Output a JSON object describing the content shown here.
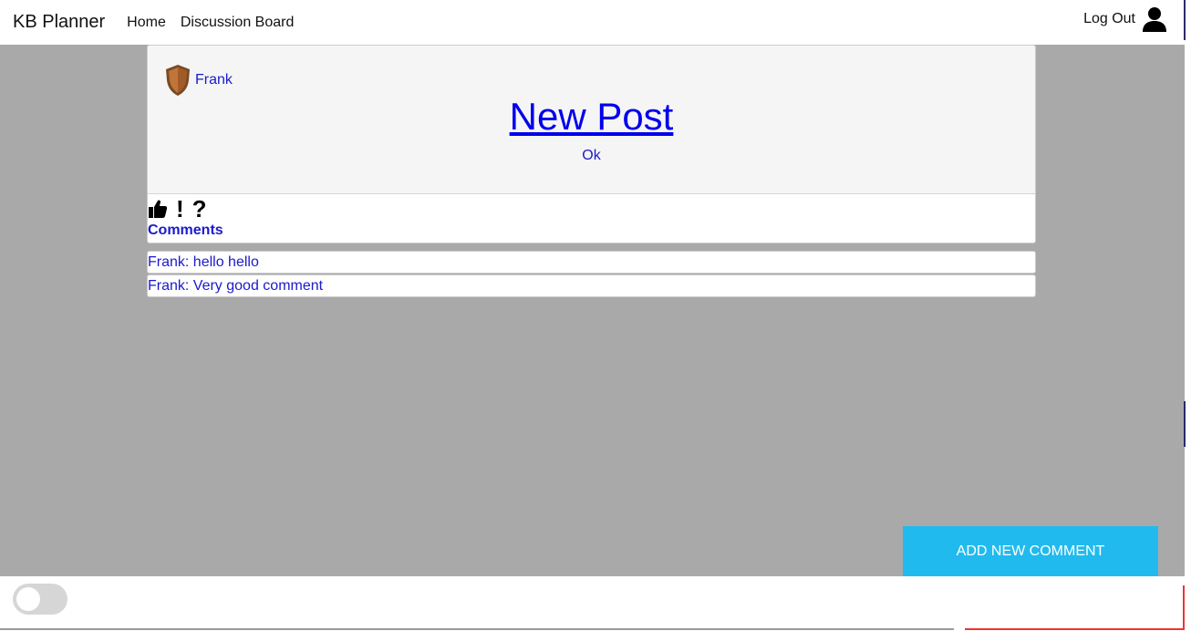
{
  "nav": {
    "brand": "KB Planner",
    "links": [
      "Home",
      "Discussion Board"
    ],
    "logout": "Log Out"
  },
  "post": {
    "author": "Frank",
    "title": "New Post",
    "body": "Ok",
    "reactions": [
      "thumbs-up",
      "!",
      "?"
    ],
    "comments_label": "Comments"
  },
  "comments": [
    {
      "text": "Frank: hello hello"
    },
    {
      "text": "Frank: Very good comment"
    }
  ],
  "actions": {
    "add_comment": "ADD NEW COMMENT"
  },
  "footer": {
    "toggle_state": "off"
  },
  "colors": {
    "background": "#a9a9a9",
    "accent": "#21baee",
    "link": "#1a1acc"
  }
}
